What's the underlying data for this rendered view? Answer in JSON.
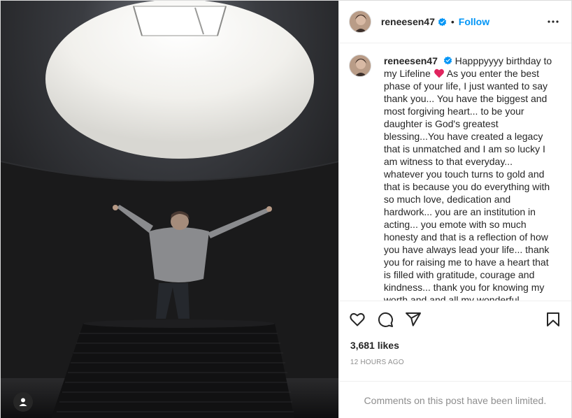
{
  "post": {
    "username": "reneesen47",
    "follow_label": "Follow",
    "separator": "•",
    "caption_username": "reneesen47",
    "caption_part1": "Happpyyyy birthday to my Lifeline",
    "caption_part2": "As you enter the best phase of your life, I just wanted to say thank you... You have the biggest and most forgiving heart... to be your daughter is God's greatest blessing...You have created a legacy that is unmatched and I am so lucky I am witness to that everyday... whatever you touch turns to gold and that is because you do everything with so much love, dedication and hardwork... you are an institution in acting... you emote with so much honesty and that is a reflection of how you have always lead your life... thank you for raising me to have a heart that is filled with gratitude, courage and kindness... thank you for knowing my worth and and all my wonderful qualities...",
    "likes": "3,681 likes",
    "time": "12 HOURS AGO",
    "comments_limited": "Comments on this post have been limited."
  },
  "icons": {
    "verified": "verified-badge-icon",
    "more": "more-options-icon",
    "like": "heart-icon",
    "comment": "comment-icon",
    "share": "share-icon",
    "save": "bookmark-icon",
    "tag": "user-tag-icon",
    "caption_emoji": "red-heart-emoji"
  },
  "colors": {
    "accent": "#0095f6",
    "heart_emoji": "#e0245e",
    "muted": "#8e8e8e"
  }
}
